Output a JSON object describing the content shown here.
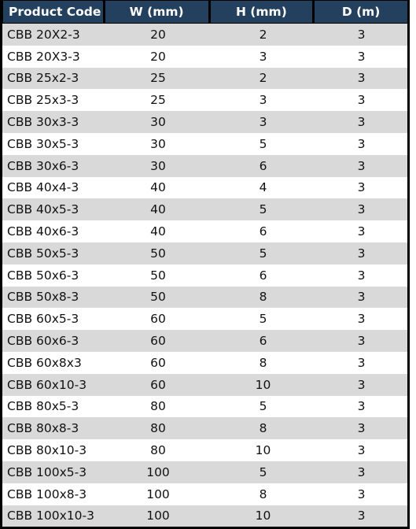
{
  "table": {
    "columns": [
      {
        "key": "code",
        "label": "Product Code",
        "align": "left"
      },
      {
        "key": "w",
        "label": "W (mm)",
        "align": "center"
      },
      {
        "key": "h",
        "label": "H (mm)",
        "align": "center"
      },
      {
        "key": "d",
        "label": "D (m)",
        "align": "center"
      }
    ],
    "colors": {
      "header_background": "#24405f",
      "header_text": "#ffffff",
      "row_shaded": "#d9d9d9",
      "row_plain": "#ffffff",
      "border": "#000000",
      "body_text": "#111111"
    },
    "rows": [
      {
        "code": "CBB 20X2-3",
        "w": "20",
        "h": "2",
        "d": "3"
      },
      {
        "code": "CBB 20X3-3",
        "w": "20",
        "h": "3",
        "d": "3"
      },
      {
        "code": "CBB 25x2-3",
        "w": "25",
        "h": "2",
        "d": "3"
      },
      {
        "code": "CBB 25x3-3",
        "w": "25",
        "h": "3",
        "d": "3"
      },
      {
        "code": "CBB 30x3-3",
        "w": "30",
        "h": "3",
        "d": "3"
      },
      {
        "code": "CBB 30x5-3",
        "w": "30",
        "h": "5",
        "d": "3"
      },
      {
        "code": "CBB 30x6-3",
        "w": "30",
        "h": "6",
        "d": "3"
      },
      {
        "code": "CBB 40x4-3",
        "w": "40",
        "h": "4",
        "d": "3"
      },
      {
        "code": "CBB 40x5-3",
        "w": "40",
        "h": "5",
        "d": "3"
      },
      {
        "code": "CBB 40x6-3",
        "w": "40",
        "h": "6",
        "d": "3"
      },
      {
        "code": "CBB 50x5-3",
        "w": "50",
        "h": "5",
        "d": "3"
      },
      {
        "code": "CBB 50x6-3",
        "w": "50",
        "h": "6",
        "d": "3"
      },
      {
        "code": "CBB 50x8-3",
        "w": "50",
        "h": "8",
        "d": "3"
      },
      {
        "code": "CBB 60x5-3",
        "w": "60",
        "h": "5",
        "d": "3"
      },
      {
        "code": "CBB 60x6-3",
        "w": "60",
        "h": "6",
        "d": "3"
      },
      {
        "code": "CBB 60x8x3",
        "w": "60",
        "h": "8",
        "d": "3"
      },
      {
        "code": "CBB 60x10-3",
        "w": "60",
        "h": "10",
        "d": "3"
      },
      {
        "code": "CBB 80x5-3",
        "w": "80",
        "h": "5",
        "d": "3"
      },
      {
        "code": "CBB 80x8-3",
        "w": "80",
        "h": "8",
        "d": "3"
      },
      {
        "code": "CBB 80x10-3",
        "w": "80",
        "h": "10",
        "d": "3"
      },
      {
        "code": "CBB 100x5-3",
        "w": "100",
        "h": "5",
        "d": "3"
      },
      {
        "code": "CBB 100x8-3",
        "w": "100",
        "h": "8",
        "d": "3"
      },
      {
        "code": "CBB 100x10-3",
        "w": "100",
        "h": "10",
        "d": "3"
      }
    ]
  }
}
